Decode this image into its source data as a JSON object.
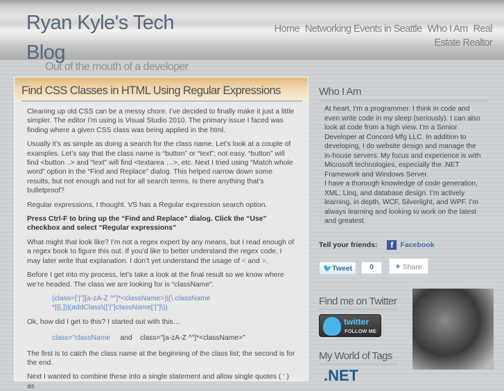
{
  "header": {
    "title": "Ryan Kyle's Tech Blog",
    "tagline": "Out of the mouth of a developer",
    "nav": [
      "Home",
      "Networking Events in Seattle",
      "Who I Am",
      "Real Estate Realtor"
    ]
  },
  "post": {
    "title": "Find CSS Classes in HTML Using Regular Expressions",
    "p1": "Cleaning up old CSS can be a messy chore. I’ve decided to finally make it just a little simpler. The editor I’m using is Visual Studio 2010. The primary issue I faced was finding where a given CSS class was being applied in the html.",
    "p2": "Usually it’s as simple as doing a search for the class name. Let’s look at a couple of examples. Let’s say that the class name is “button” or “text”; not easy. “button” will find <button ..> and “text” will find <textarea …>, etc. Next I tried using “Match whole word” option in the “Find and Replace” dialog. This helped narrow down some results, but not enough and not for all search terms. Is there anything that’s bulletproof?",
    "p3": "Regular expressions, I thought. VS has a Regular expression search option.",
    "p4": "Press Ctrl-F to bring up the “Find and Replace” dialog. Click the “Use” checkbox and select “Regular expressions”",
    "p5": "What might that look like? I’m not a regex expert by any means, but I read enough of a regex book to figure this out. If you’d like to better understand the regex code, I may later write that explanation. I don’t yet understand the usage of ",
    "lt": "<",
    "and": " and ",
    "gt": ">",
    "p6": "Before I get into my process, let’s take a look at the final result so we know where we’re headed. The class we are looking for is “className”.",
    "code1a": "(class=[‘|\"][a-zA-Z ^\"]*<className>)|(\\.className",
    "code1b": "*[{|,])|(addClass\\([‘|\"]className[‘|\"]\\))",
    "p7": "Ok, how did I get to this? I started out with this…",
    "code2a": "class=\"className",
    "code2and": "and",
    "code2b": "class=\"[a-zA-Z ^\"]*<className>\"",
    "p8": "The first is to catch the class name at the beginning of the class list; the second is for the end.",
    "p9": "Next I wanted to combine these into a single statement and allow single quotes ( ‘ ) as"
  },
  "sidebar": {
    "who_title": "Who I Am",
    "about1": "At heart, I’m a programmer. I think in code and even write code in my sleep (seriously). I can also look at code from a high view. I’m a Senior Developer at Concord Mfg LLC. In addition to developing, I do website design and manage the in-house servers. My focus and experience is with Microsoft technologies, especially the .NET Framework and Windows Server.",
    "about2": "I have a thorough knowledge of code generation, XML, Linq, and database design. I’m actively learning, in depth, WCF, Silverlight, and WPF. I’m always learning and looking to work on the latest and greatest.",
    "tell": "Tell your friends:",
    "facebook": "Facebook",
    "tweet": "Tweet",
    "tweet_count": "0",
    "share": "Share",
    "twitter_title": "Find me on Twitter",
    "twitter_logo": "twitter",
    "follow_me": "FOLLOW ME",
    "tags_title": "My World of Tags",
    "tag1": ".NET"
  }
}
